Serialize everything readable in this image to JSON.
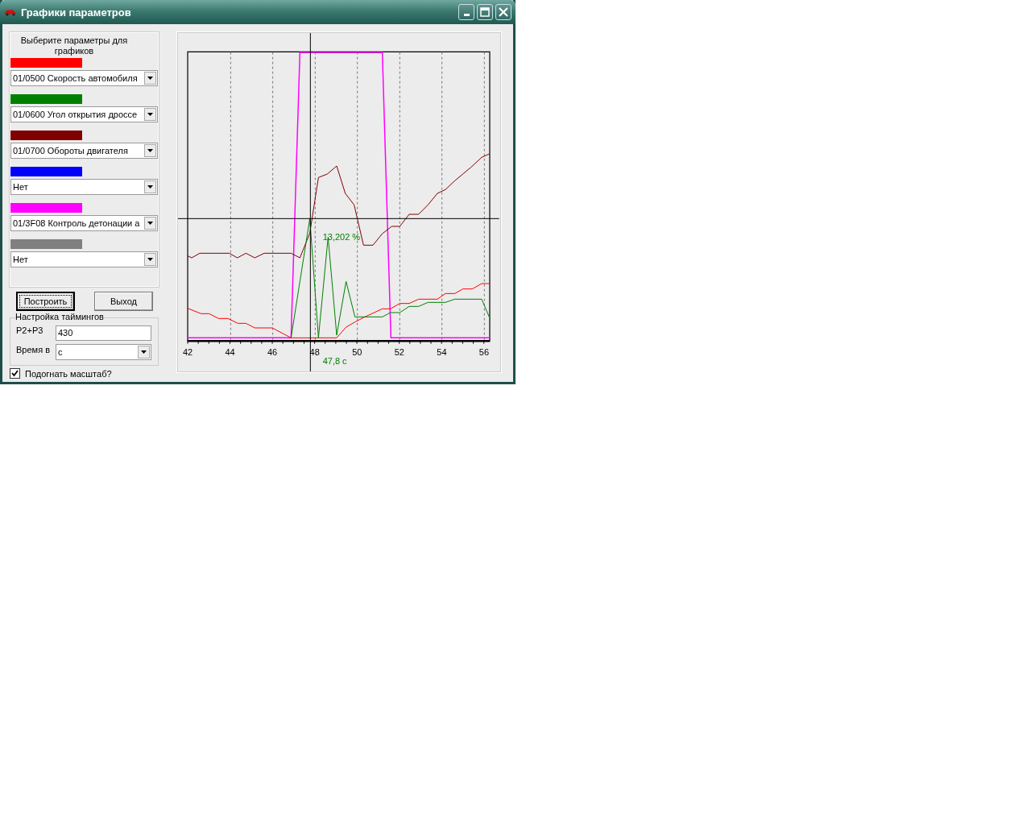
{
  "window": {
    "title": "Графики параметров"
  },
  "parameters_group": {
    "heading": "Выберите параметры для графиков",
    "parameters": [
      {
        "color": "#ff0000",
        "value": "01/0500 Скорость автомобиля"
      },
      {
        "color": "#008000",
        "value": "01/0600 Угол открытия дроссе"
      },
      {
        "color": "#800000",
        "value": "01/0700 Обороты двигателя"
      },
      {
        "color": "#0000ff",
        "value": "Нет"
      },
      {
        "color": "#ff00ff",
        "value": "01/3F08 Контроль детонации а"
      },
      {
        "color": "#808080",
        "value": "Нет"
      }
    ]
  },
  "buttons": [
    {
      "label": "Построить",
      "focused": true
    },
    {
      "label": "Выход",
      "focused": false
    }
  ],
  "timings": {
    "title": "Настройка таймингов",
    "p_label": "P2+P3",
    "p_value": "430",
    "time_label": "Время в",
    "time_unit": "с"
  },
  "fit_scale": {
    "label": "Подогнать масштаб?",
    "checked": true
  },
  "chart": {
    "x_tick_labels": [
      "42",
      "44",
      "46",
      "48",
      "50",
      "52",
      "54",
      "56"
    ],
    "cursor_value": "13,202 %",
    "cursor_time": "47,8 с"
  }
}
